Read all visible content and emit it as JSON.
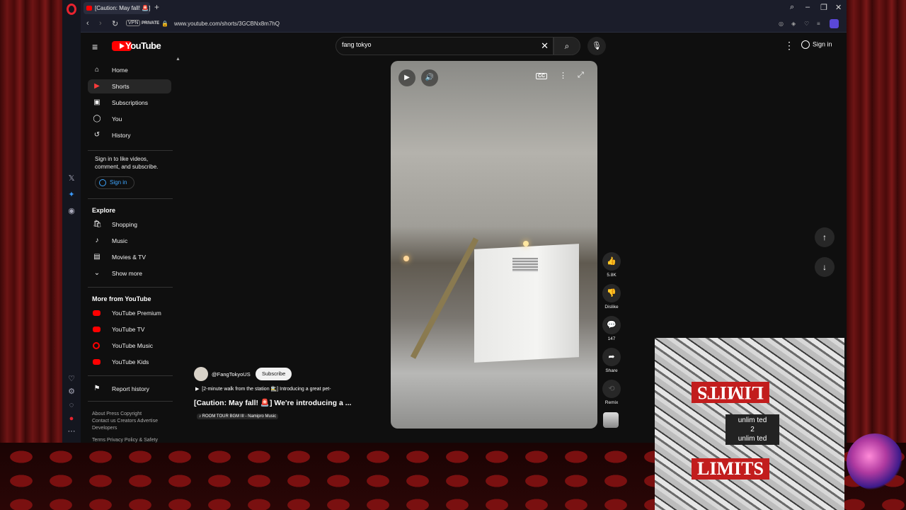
{
  "browser": {
    "tab_title": "[Caution: May fall! 🚨] We",
    "url": "www.youtube.com/shorts/3GCBNx8m7hQ",
    "vpn_label": "VPN",
    "private_label": "PRIVATE"
  },
  "header": {
    "logo_text": "YouTube",
    "search_value": "fang tokyo",
    "sign_in": "Sign in"
  },
  "sidebar": {
    "items": [
      {
        "label": "Home",
        "icon": "home-icon"
      },
      {
        "label": "Shorts",
        "icon": "shorts-icon"
      },
      {
        "label": "Subscriptions",
        "icon": "subscriptions-icon"
      },
      {
        "label": "You",
        "icon": "you-icon"
      },
      {
        "label": "History",
        "icon": "history-icon"
      }
    ],
    "signin_note": "Sign in to like videos, comment, and subscribe.",
    "signin_button": "Sign in",
    "explore_heading": "Explore",
    "explore": [
      {
        "label": "Shopping",
        "icon": "shopping-icon"
      },
      {
        "label": "Music",
        "icon": "music-icon"
      },
      {
        "label": "Movies & TV",
        "icon": "movies-icon"
      },
      {
        "label": "Show more",
        "icon": "chevron-down-icon"
      }
    ],
    "more_heading": "More from YouTube",
    "more": [
      {
        "label": "YouTube Premium"
      },
      {
        "label": "YouTube TV"
      },
      {
        "label": "YouTube Music"
      },
      {
        "label": "YouTube Kids"
      }
    ],
    "report_history": "Report history",
    "footer1": "About  Press  Copyright",
    "footer2": "Contact us  Creators  Advertise",
    "footer3": "Developers",
    "footer4": "Terms  Privacy  Policy & Safety"
  },
  "short": {
    "channel": "@FangTokyoUS",
    "subscribe": "Subscribe",
    "description": "[2-minute walk from the station 🚉] Introducing a great pet-",
    "title": "[Caution: May fall! 🚨] We're introducing a ...",
    "music": "♪ ROOM TOUR BGM III - Namipro Music",
    "cc_label": "CC"
  },
  "actions": {
    "like_count": "5.8K",
    "dislike": "Dislike",
    "comments": "147",
    "share": "Share",
    "remix": "Remix"
  },
  "album": {
    "top_text": "LIMITS",
    "middle_line1": "unlim ted",
    "middle_line2": "2",
    "middle_line3": "unlim ted",
    "bottom_text": "LIMITS"
  }
}
